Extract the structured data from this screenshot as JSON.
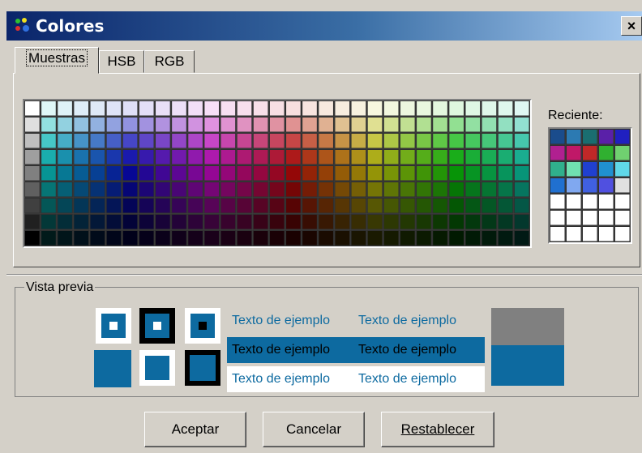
{
  "window": {
    "title": "Colores",
    "close_glyph": "×",
    "icon": "palette-icon"
  },
  "tabs": [
    {
      "label": "Muestras",
      "active": true
    },
    {
      "label": "HSB",
      "active": false
    },
    {
      "label": "RGB",
      "active": false
    }
  ],
  "swatches": {
    "columns": 31,
    "rows": 9
  },
  "recent": {
    "label": "Reciente:",
    "columns": 5,
    "rows": 7,
    "colors": [
      "#1a4c8c",
      "#2c7ab2",
      "#1a6e70",
      "#5a20a8",
      "#2020c0",
      "#b02090",
      "#c01868",
      "#c02828",
      "#30b030",
      "#70d070",
      "#30b08c",
      "#70e0b0",
      "#2040d0",
      "#2090d0",
      "#60d8e8",
      "#2070d0",
      "#80a8f0",
      "#4060e0",
      "#5050e0",
      "#e0e0e0"
    ],
    "empty_color": "#ffffff"
  },
  "preview": {
    "label": "Vista previa",
    "sample_text": "Texto de ejemplo",
    "color": "#0d6aa0",
    "previous_color": "#808080"
  },
  "buttons": {
    "accept": "Aceptar",
    "cancel": "Cancelar",
    "reset": "Restablecer"
  }
}
